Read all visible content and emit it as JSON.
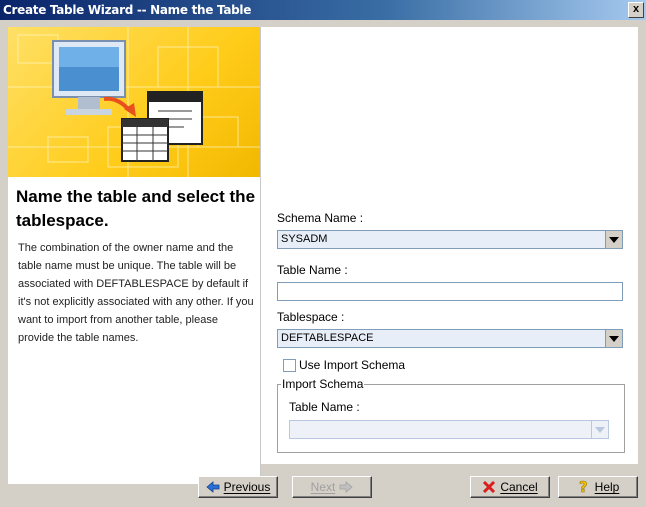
{
  "window": {
    "title": "Create Table Wizard -- Name the Table",
    "close_glyph": "x"
  },
  "left_panel": {
    "heading": "Name the table and select the tablespace.",
    "description": "The combination of the owner name and the table name must be unique. The table will be associated with DEFTABLESPACE by default if it's not explicitly associated with any other.  If you want to import from another table, please provide the table names."
  },
  "form": {
    "schema_name": {
      "label": "Schema Name :",
      "value": "SYSADM"
    },
    "table_name": {
      "label": "Table Name :",
      "value": ""
    },
    "tablespace": {
      "label": "Tablespace :",
      "value": "DEFTABLESPACE"
    },
    "use_import_schema": {
      "label": "Use Import Schema",
      "checked": false
    },
    "import_schema": {
      "legend": "Import Schema",
      "table_name_label": "Table Name :",
      "table_name_value": ""
    }
  },
  "buttons": {
    "previous": "Previous",
    "next": "Next",
    "cancel": "Cancel",
    "help": "Help"
  },
  "colors": {
    "title_bar": "#0a246a",
    "banner": "#ffcc1a",
    "dialog_face": "#d4d0c8"
  },
  "icons": {
    "banner": "computer-to-table-illustration",
    "previous": "left-arrow-icon",
    "next": "right-arrow-icon",
    "cancel": "red-x-icon",
    "help": "question-mark-icon"
  }
}
